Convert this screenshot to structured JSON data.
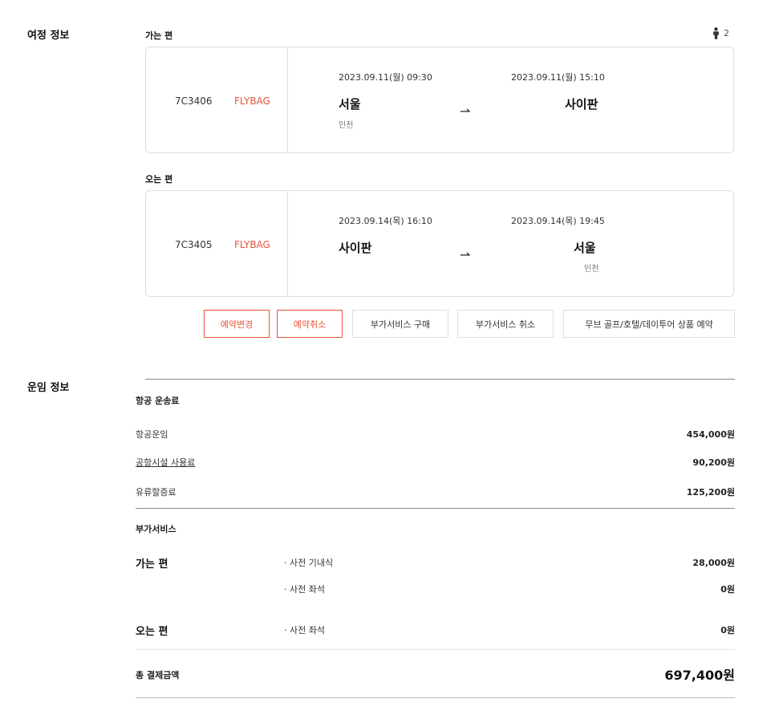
{
  "itinerary": {
    "section_title": "여정 정보",
    "passenger_count": "2",
    "outbound": {
      "label": "가는 편",
      "flight_no": "7C3406",
      "fare_type": "FLYBAG",
      "dep_datetime": "2023.09.11(월) 09:30",
      "arr_datetime": "2023.09.11(월) 15:10",
      "dep_city": "서울",
      "dep_airport": "인천",
      "arr_city": "사이판",
      "arr_airport": ""
    },
    "inbound": {
      "label": "오는 편",
      "flight_no": "7C3405",
      "fare_type": "FLYBAG",
      "dep_datetime": "2023.09.14(목) 16:10",
      "arr_datetime": "2023.09.14(목) 19:45",
      "dep_city": "사이판",
      "dep_airport": "",
      "arr_city": "서울",
      "arr_airport": "인천"
    },
    "buttons": {
      "change": "예약변경",
      "cancel": "예약취소",
      "addon_buy": "부가서비스 구매",
      "addon_cancel": "부가서비스 취소",
      "package": "무브 골프/호텔/데이투어 상품 예약"
    }
  },
  "fare": {
    "section_title": "운임 정보",
    "air_fare_title": "항공 운송료",
    "items": [
      {
        "label": "항공운임",
        "amount": "454,000원"
      },
      {
        "label": "공항시설 사용료",
        "amount": "90,200원"
      },
      {
        "label": "유류할증료",
        "amount": "125,200원"
      }
    ],
    "addon_title": "부가서비스",
    "outbound_label": "가는 편",
    "outbound_services": [
      {
        "name": "· 사전 기내식",
        "amount": "28,000원"
      },
      {
        "name": "· 사전 좌석",
        "amount": "0원"
      }
    ],
    "inbound_label": "오는 편",
    "inbound_services": [
      {
        "name": "· 사전 좌석",
        "amount": "0원"
      }
    ],
    "total_label": "총 결제금액",
    "total_amount": "697,400원"
  },
  "colors": {
    "accent": "#e8533a"
  }
}
